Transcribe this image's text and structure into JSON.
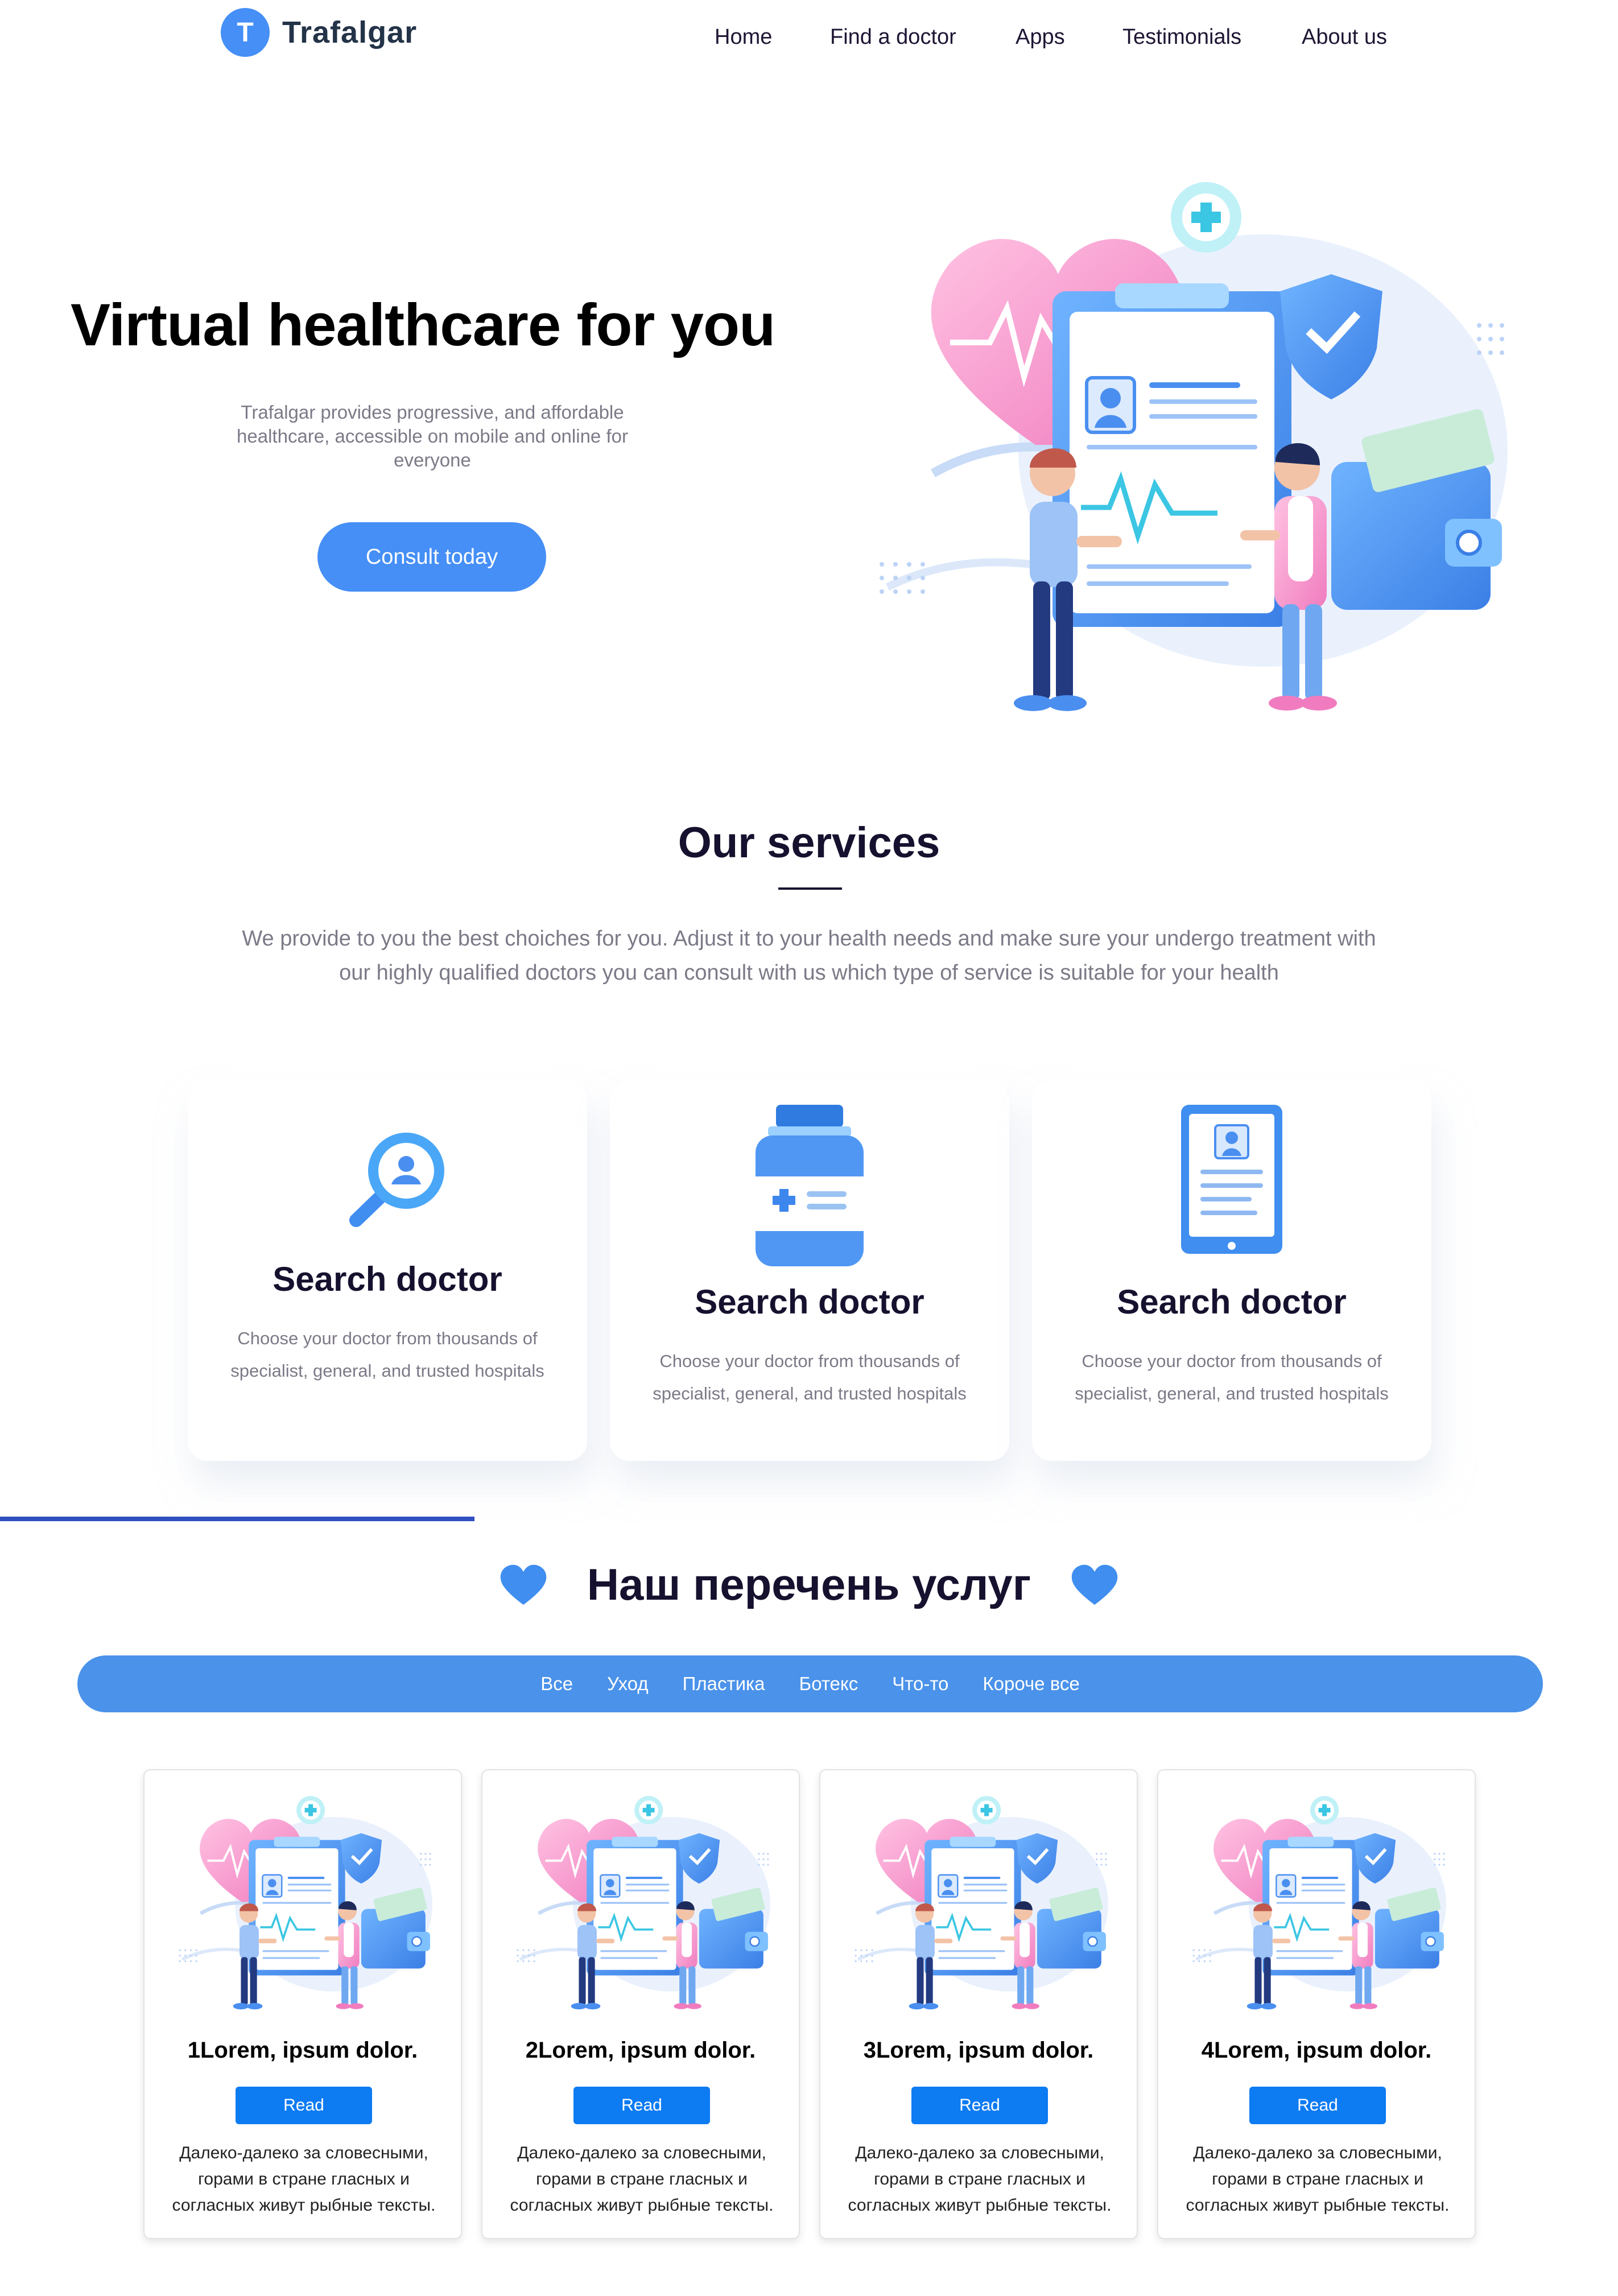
{
  "header": {
    "logo_letter": "T",
    "brand": "Trafalgar",
    "nav": [
      "Home",
      "Find a doctor",
      "Apps",
      "Testimonials",
      "About us"
    ]
  },
  "hero": {
    "title": "Virtual healthcare for you",
    "description": "Trafalgar provides progressive, and affordable healthcare, accessible on mobile and online for everyone",
    "cta_label": "Consult today"
  },
  "services": {
    "title": "Our services",
    "description": "We provide to you the best choiches for you. Adjust it to your health needs and make sure your undergo treatment with our highly qualified doctors you can consult with us which type of service is suitable for your health",
    "cards": [
      {
        "icon": "magnifier-icon",
        "title": "Search doctor",
        "description": "Choose your doctor from thousands of specialist, general, and trusted hospitals"
      },
      {
        "icon": "medicine-jar-icon",
        "title": "Search doctor",
        "description": "Choose your doctor from thousands of specialist, general, and trusted hospitals"
      },
      {
        "icon": "tablet-profile-icon",
        "title": "Search doctor",
        "description": "Choose your doctor from thousands of specialist, general, and trusted hospitals"
      }
    ]
  },
  "price_list": {
    "title": "Наш перечень услуг",
    "filters": [
      "Все",
      "Уход",
      "Пластика",
      "Ботекс",
      "Что-то",
      "Короче все"
    ],
    "cards": [
      {
        "title": "1Lorem, ipsum dolor.",
        "button": "Read",
        "description": "Далеко-далеко за словесными, горами в стране гласных и согласных живут рыбные тексты."
      },
      {
        "title": "2Lorem, ipsum dolor.",
        "button": "Read",
        "description": "Далеко-далеко за словесными, горами в стране гласных и согласных живут рыбные тексты."
      },
      {
        "title": "3Lorem, ipsum dolor.",
        "button": "Read",
        "description": "Далеко-далеко за словесными, горами в стране гласных и согласных живут рыбные тексты."
      },
      {
        "title": "4Lorem, ipsum dolor.",
        "button": "Read",
        "description": "Далеко-далеко за словесными, горами в стране гласных и согласных живут рыбные тексты."
      }
    ]
  },
  "colors": {
    "primary": "#458ff6",
    "filter_bar": "#4a92ea",
    "button": "#0d7bf2",
    "heading": "#15112e",
    "muted_text": "#7d7987",
    "accent_pink": "#f6a7d6",
    "divider_blue": "#2f4ec0"
  }
}
